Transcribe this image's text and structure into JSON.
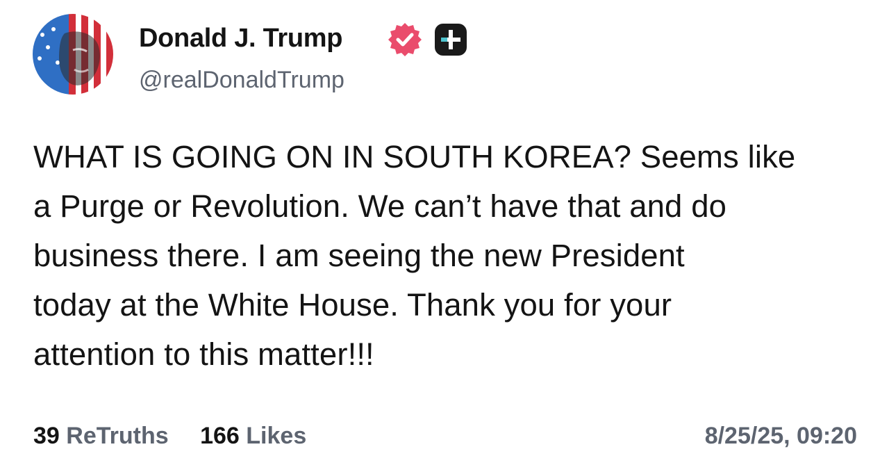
{
  "author": {
    "display_name": "Donald J. Trump",
    "handle": "@realDonaldTrump",
    "avatar_icon": "avatar-flag-portrait",
    "verified_icon": "verified-badge-icon",
    "verified_color": "#ea4c6c",
    "extra_badge_icon": "plus-badge-icon"
  },
  "post": {
    "lines": [
      "WHAT IS GOING ON IN SOUTH KOREA? Seems like",
      "a Purge or Revolution. We can’t have that and do",
      "business there. I am seeing the new President",
      "today at the White House. Thank you for your",
      "attention to this matter!!!"
    ]
  },
  "stats": {
    "retruths_count": "39",
    "retruths_label": "ReTruths",
    "likes_count": "166",
    "likes_label": "Likes"
  },
  "timestamp": "8/25/25, 09:20",
  "colors": {
    "text": "#141414",
    "muted": "#5d6470",
    "background": "#ffffff"
  }
}
